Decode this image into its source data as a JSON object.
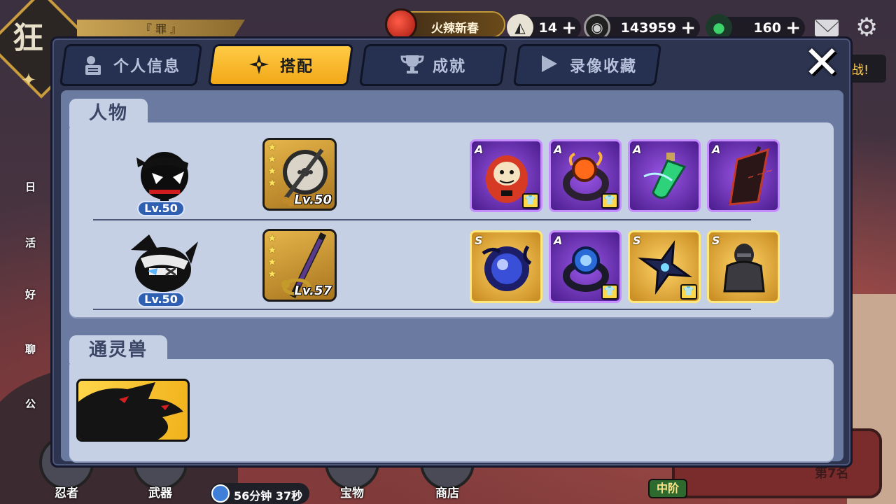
{
  "background": {
    "logo_char": "狂",
    "title_strip": "『 罪 』",
    "event_label": "火辣新春",
    "resources": [
      {
        "icon": "rice-ball-icon",
        "value": "14"
      },
      {
        "icon": "coin-icon",
        "value": "143959"
      },
      {
        "icon": "green-gem-icon",
        "value": "160"
      }
    ],
    "right_chip": "战!",
    "left_menu": [
      "日",
      "活",
      "好",
      "聊",
      "公"
    ],
    "bottom_nav": [
      "忍者",
      "武器",
      "宝物",
      "商店"
    ],
    "timer": "56分钟 37秒",
    "rank_tier": "中阶",
    "rank_text": "第7名"
  },
  "modal": {
    "tabs": [
      {
        "label": "个人信息",
        "icon": "profile-icon",
        "active": false
      },
      {
        "label": "搭配",
        "icon": "shuriken-icon",
        "active": true
      },
      {
        "label": "成就",
        "icon": "trophy-icon",
        "active": false
      },
      {
        "label": "录像收藏",
        "icon": "play-icon",
        "active": false
      }
    ],
    "close_symbol": "✕"
  },
  "characters_section": {
    "title": "人物",
    "rows": [
      {
        "level": "Lv.50",
        "weapon_level": "Lv.50",
        "weapon_stars": 4,
        "gear": [
          {
            "grade": "A",
            "rarity": "purple",
            "icon": "daruma-icon",
            "has_badge": true
          },
          {
            "grade": "A",
            "rarity": "purple",
            "icon": "ring-icon",
            "has_badge": true
          },
          {
            "grade": "A",
            "rarity": "purple",
            "icon": "potion-icon",
            "has_badge": false
          },
          {
            "grade": "A",
            "rarity": "purple",
            "icon": "banner-icon",
            "has_badge": false
          }
        ]
      },
      {
        "level": "Lv.50",
        "weapon_level": "Lv.57",
        "weapon_stars": 4,
        "gear": [
          {
            "grade": "S",
            "rarity": "gold",
            "icon": "dark-orb-icon",
            "has_badge": false
          },
          {
            "grade": "A",
            "rarity": "purple",
            "icon": "blue-ring-icon",
            "has_badge": true
          },
          {
            "grade": "S",
            "rarity": "gold",
            "icon": "shuriken-gear-icon",
            "has_badge": true
          },
          {
            "grade": "S",
            "rarity": "gold",
            "icon": "armor-icon",
            "has_badge": false
          }
        ]
      }
    ]
  },
  "beast_section": {
    "title": "通灵兽"
  },
  "colors": {
    "active_tab": "#ffc12e",
    "panel": "#c6d0e4",
    "modal": "#2c3450"
  }
}
